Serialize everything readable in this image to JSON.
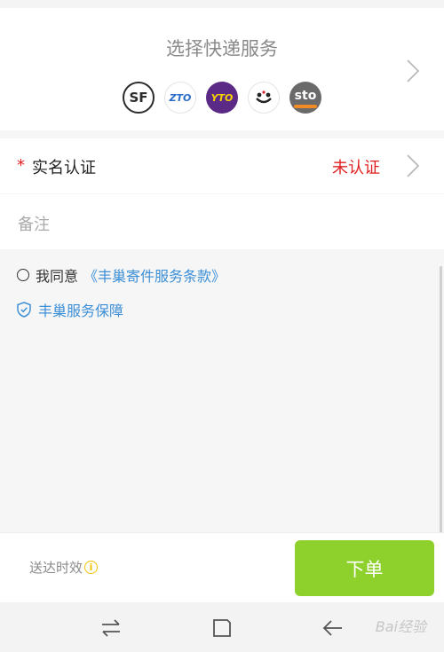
{
  "courier": {
    "title": "选择快递服务",
    "logos": [
      {
        "name": "sf-express",
        "text": "SF",
        "color": "#2b2b2b"
      },
      {
        "name": "zto-express",
        "text": "ZTO",
        "color": "#2a6cc7"
      },
      {
        "name": "yto-express",
        "text": "YTO",
        "color": "#5b2a86"
      },
      {
        "name": "best-express",
        "text": "•ᴗ•",
        "color": "#222222"
      },
      {
        "name": "sto-express",
        "text": "sto",
        "color": "#f08a24"
      }
    ]
  },
  "auth": {
    "required_mark": "*",
    "label": "实名认证",
    "status": "未认证"
  },
  "note": {
    "placeholder": "备注"
  },
  "agreement": {
    "text": "我同意",
    "link": "《丰巢寄件服务条款》"
  },
  "guarantee": {
    "label": "丰巢服务保障"
  },
  "bottom": {
    "delivery_label": "送达时效",
    "info_icon": "i",
    "order_button": "下单"
  },
  "watermark": "Bai经验"
}
